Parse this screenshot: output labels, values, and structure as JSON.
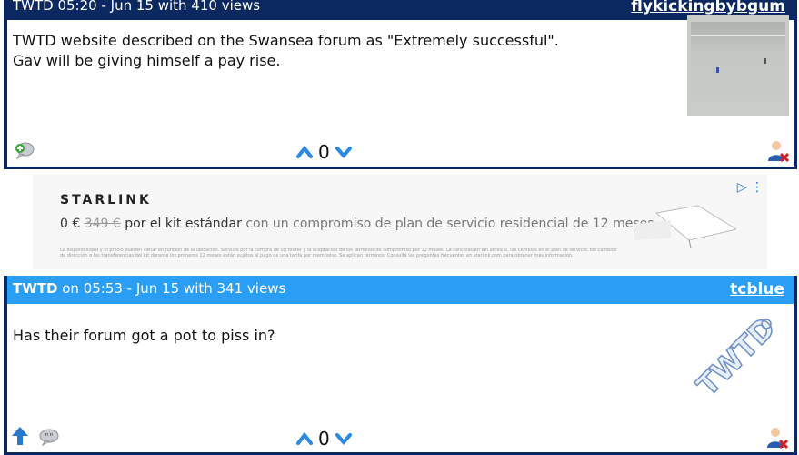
{
  "post1": {
    "header_meta": "TWTD 05:20 - Jun 15 with 410 views",
    "author": "flykickingbybgum",
    "text_line1": "TWTD website described on the Swansea forum as \"Extremely successful\".",
    "text_line2": "Gav will be giving himself a pay rise.",
    "votes": "0"
  },
  "ad": {
    "brand": "STARLINK",
    "price": "0 €",
    "old_price": "349 €",
    "offer_main": "por el kit estándar",
    "offer_rest": "con un compromiso de plan de servicio residencial de 12 meses",
    "fine_print": "La disponibilidad y el precio pueden variar en función de la ubicación. Servicio por la compra de un router y la aceptación de los Términos de compromiso por 12 meses. La cancelación del servicio, los cambios en el plan de servicio, los cambios de dirección o las transferencias del kit durante los primeros 12 meses están sujetos al pago de una tarifa por reembolso. Se aplican términos. Consulte las preguntas frecuentes en starlink.com para obtener más información."
  },
  "post2": {
    "header_team": "TWTD",
    "header_rest": " on 05:53 - Jun 15 with 341 views",
    "author": "tcblue",
    "text": "Has their forum got a pot to piss in?",
    "votes": "0"
  }
}
